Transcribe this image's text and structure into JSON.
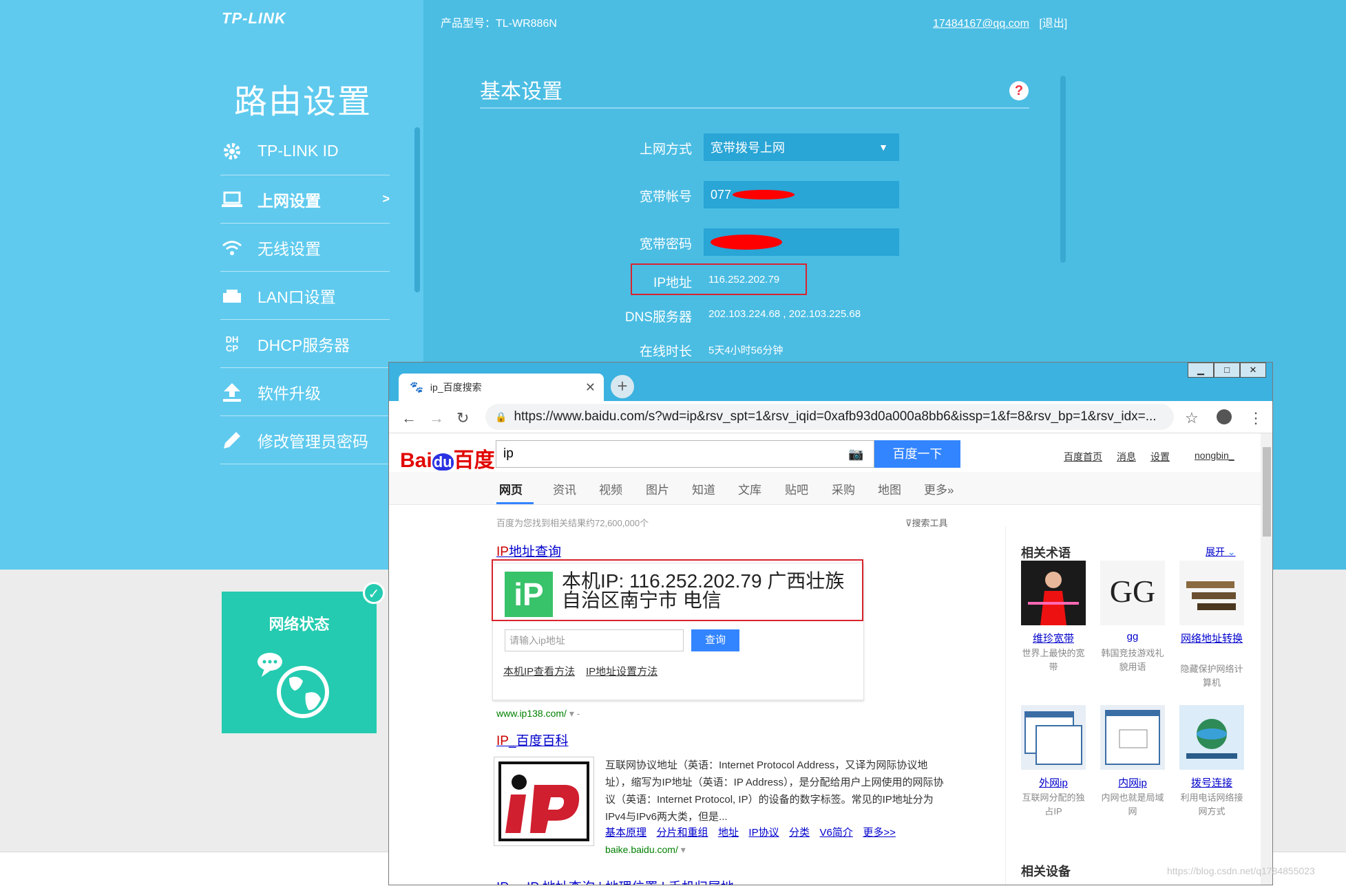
{
  "router": {
    "brand": "TP-LINK",
    "model": "产品型号：TL-WR886N",
    "account_email": "17484167@qq.com",
    "logout": "[退出]",
    "sidebar_title": "路由设置",
    "sidebar_items": [
      {
        "label": "TP-LINK ID",
        "icon": "gear-icon"
      },
      {
        "label": "上网设置",
        "icon": "laptop-icon",
        "arrow": ">"
      },
      {
        "label": "无线设置",
        "icon": "wifi-icon"
      },
      {
        "label": "LAN口设置",
        "icon": "lan-port-icon"
      },
      {
        "label": "DHCP服务器",
        "icon": "dhcp-icon",
        "icon_text": "DH\nCP"
      },
      {
        "label": "软件升级",
        "icon": "upload-icon"
      },
      {
        "label": "修改管理员密码",
        "icon": "pencil-icon"
      }
    ],
    "section_title": "基本设置",
    "help_icon": "?",
    "form": {
      "mode_label": "上网方式",
      "mode_value": "宽带拨号上网",
      "account_label": "宽带帐号",
      "account_value": "077",
      "password_label": "宽带密码",
      "ip_label": "IP地址",
      "ip_value": "116.252.202.79",
      "dns_label": "DNS服务器",
      "dns_value": "202.103.224.68 , 202.103.225.68",
      "uptime_label": "在线时长",
      "uptime_value": "5天4小时56分钟"
    },
    "network_status": "网络状态",
    "colors": {
      "sidebar": "#5fcaee",
      "main": "#4bbde3",
      "teal": "#24cbb0"
    }
  },
  "browser": {
    "tab_title": "ip_百度搜索",
    "url": "https://www.baidu.com/s?wd=ip&rsv_spt=1&rsv_iqid=0xafb93d0a000a8bb6&issp=1&f=8&rsv_bp=1&rsv_idx=...",
    "baidu": {
      "logo_bai": "Bai",
      "logo_du": "du",
      "logo_cn": "百度",
      "query": "ip",
      "search_button": "百度一下",
      "top_links": [
        "百度首页",
        "消息",
        "设置",
        "nongbin_"
      ],
      "tabs": [
        "网页",
        "资讯",
        "视频",
        "图片",
        "知道",
        "文库",
        "贴吧",
        "采购",
        "地图",
        "更多»"
      ],
      "result_count": "百度为您找到相关结果约72,600,000个",
      "search_tools": "搜索工具",
      "result1": {
        "title_hl": "IP",
        "title_rest": "地址查询",
        "badge": "iP",
        "ip_line": "本机IP: 116.252.202.79  广西壮族自治区南宁市 电信",
        "input_placeholder": "请输入ip地址",
        "query_button": "查询",
        "link1": "本机IP查看方法",
        "link2": "IP地址设置方法",
        "url": "www.ip138.com/"
      },
      "result2": {
        "title_hl": "IP",
        "title_rest": "_百度百科",
        "text": "互联网协议地址（英语：Internet Protocol Address，又译为网际协议地址），缩写为IP地址（英语：IP Address），是分配给用户上网使用的网际协议（英语：Internet Protocol, IP）的设备的数字标签。常见的IP地址分为IPv4与IPv6两大类，但是...",
        "links": [
          "基本原理",
          "分片和重组",
          "地址",
          "IP协议",
          "分类",
          "V6简介",
          "更多>>"
        ],
        "url": "baike.baidu.com/"
      },
      "result3_partial": "IP ... IP 地址查询 | 地理位置 | 手机归属地",
      "related_title": "相关术语",
      "expand": "展开",
      "related": [
        {
          "name": "维珍宽带",
          "desc": "世界上最快的宽带"
        },
        {
          "name": "gg",
          "desc": "韩国竞技游戏礼貌用语"
        },
        {
          "name": "网络地址转换",
          "desc": "隐藏保护网络计算机"
        },
        {
          "name": "外网ip",
          "desc": "互联网分配的独占IP"
        },
        {
          "name": "内网ip",
          "desc": "内网也就是局域网"
        },
        {
          "name": "拨号连接",
          "desc": "利用电话网络接网方式"
        }
      ],
      "related_devices": "相关设备"
    }
  },
  "watermark": "https://blog.csdn.net/q1784855023"
}
